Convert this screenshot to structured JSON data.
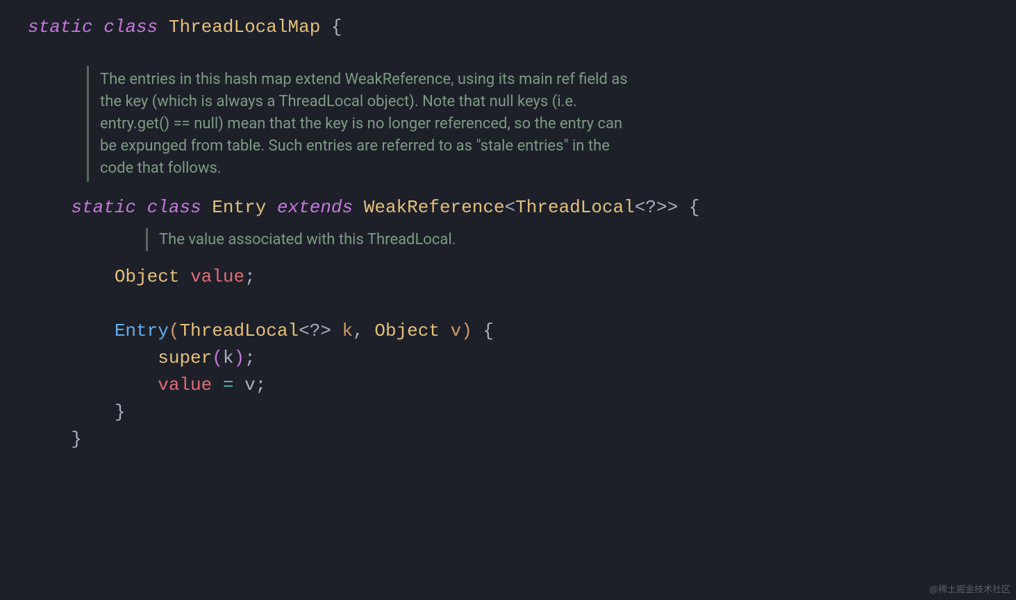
{
  "line1": {
    "static": "static",
    "class": "class",
    "name": "ThreadLocalMap",
    "brace": " {"
  },
  "doc1": "The entries in this hash map extend WeakReference, using its main ref field as the key (which is always a ThreadLocal object). Note that null keys (i.e. entry.get() == null) mean that the key is no longer referenced, so the entry can be expunged from table. Such entries are referred to as \"stale entries\" in the code that follows.",
  "line2": {
    "static": "static",
    "class": "class",
    "name": "Entry",
    "extends": "extends",
    "parent": "WeakReference",
    "lt": "<",
    "tl": "ThreadLocal",
    "q": "<?>",
    "gt": ">",
    "brace": " {"
  },
  "doc2": "The value associated with this ThreadLocal.",
  "field": {
    "type": "Object",
    "name": "value",
    "semi": ";"
  },
  "ctor": {
    "name": "Entry",
    "open": "(",
    "p1type": "ThreadLocal",
    "p1q": "<?>",
    "p1name": " k",
    "comma": ", ",
    "p2type": "Object",
    "p2name": " v",
    "close": ")",
    "brace": " {"
  },
  "body1": {
    "super": "super",
    "open": "(",
    "arg": "k",
    "close": ")",
    "semi": ";"
  },
  "body2": {
    "lhs": "value",
    "eq": " = ",
    "rhs": "v",
    "semi": ";"
  },
  "close1": "}",
  "close2": "}",
  "watermark": "@稀土掘金技术社区"
}
